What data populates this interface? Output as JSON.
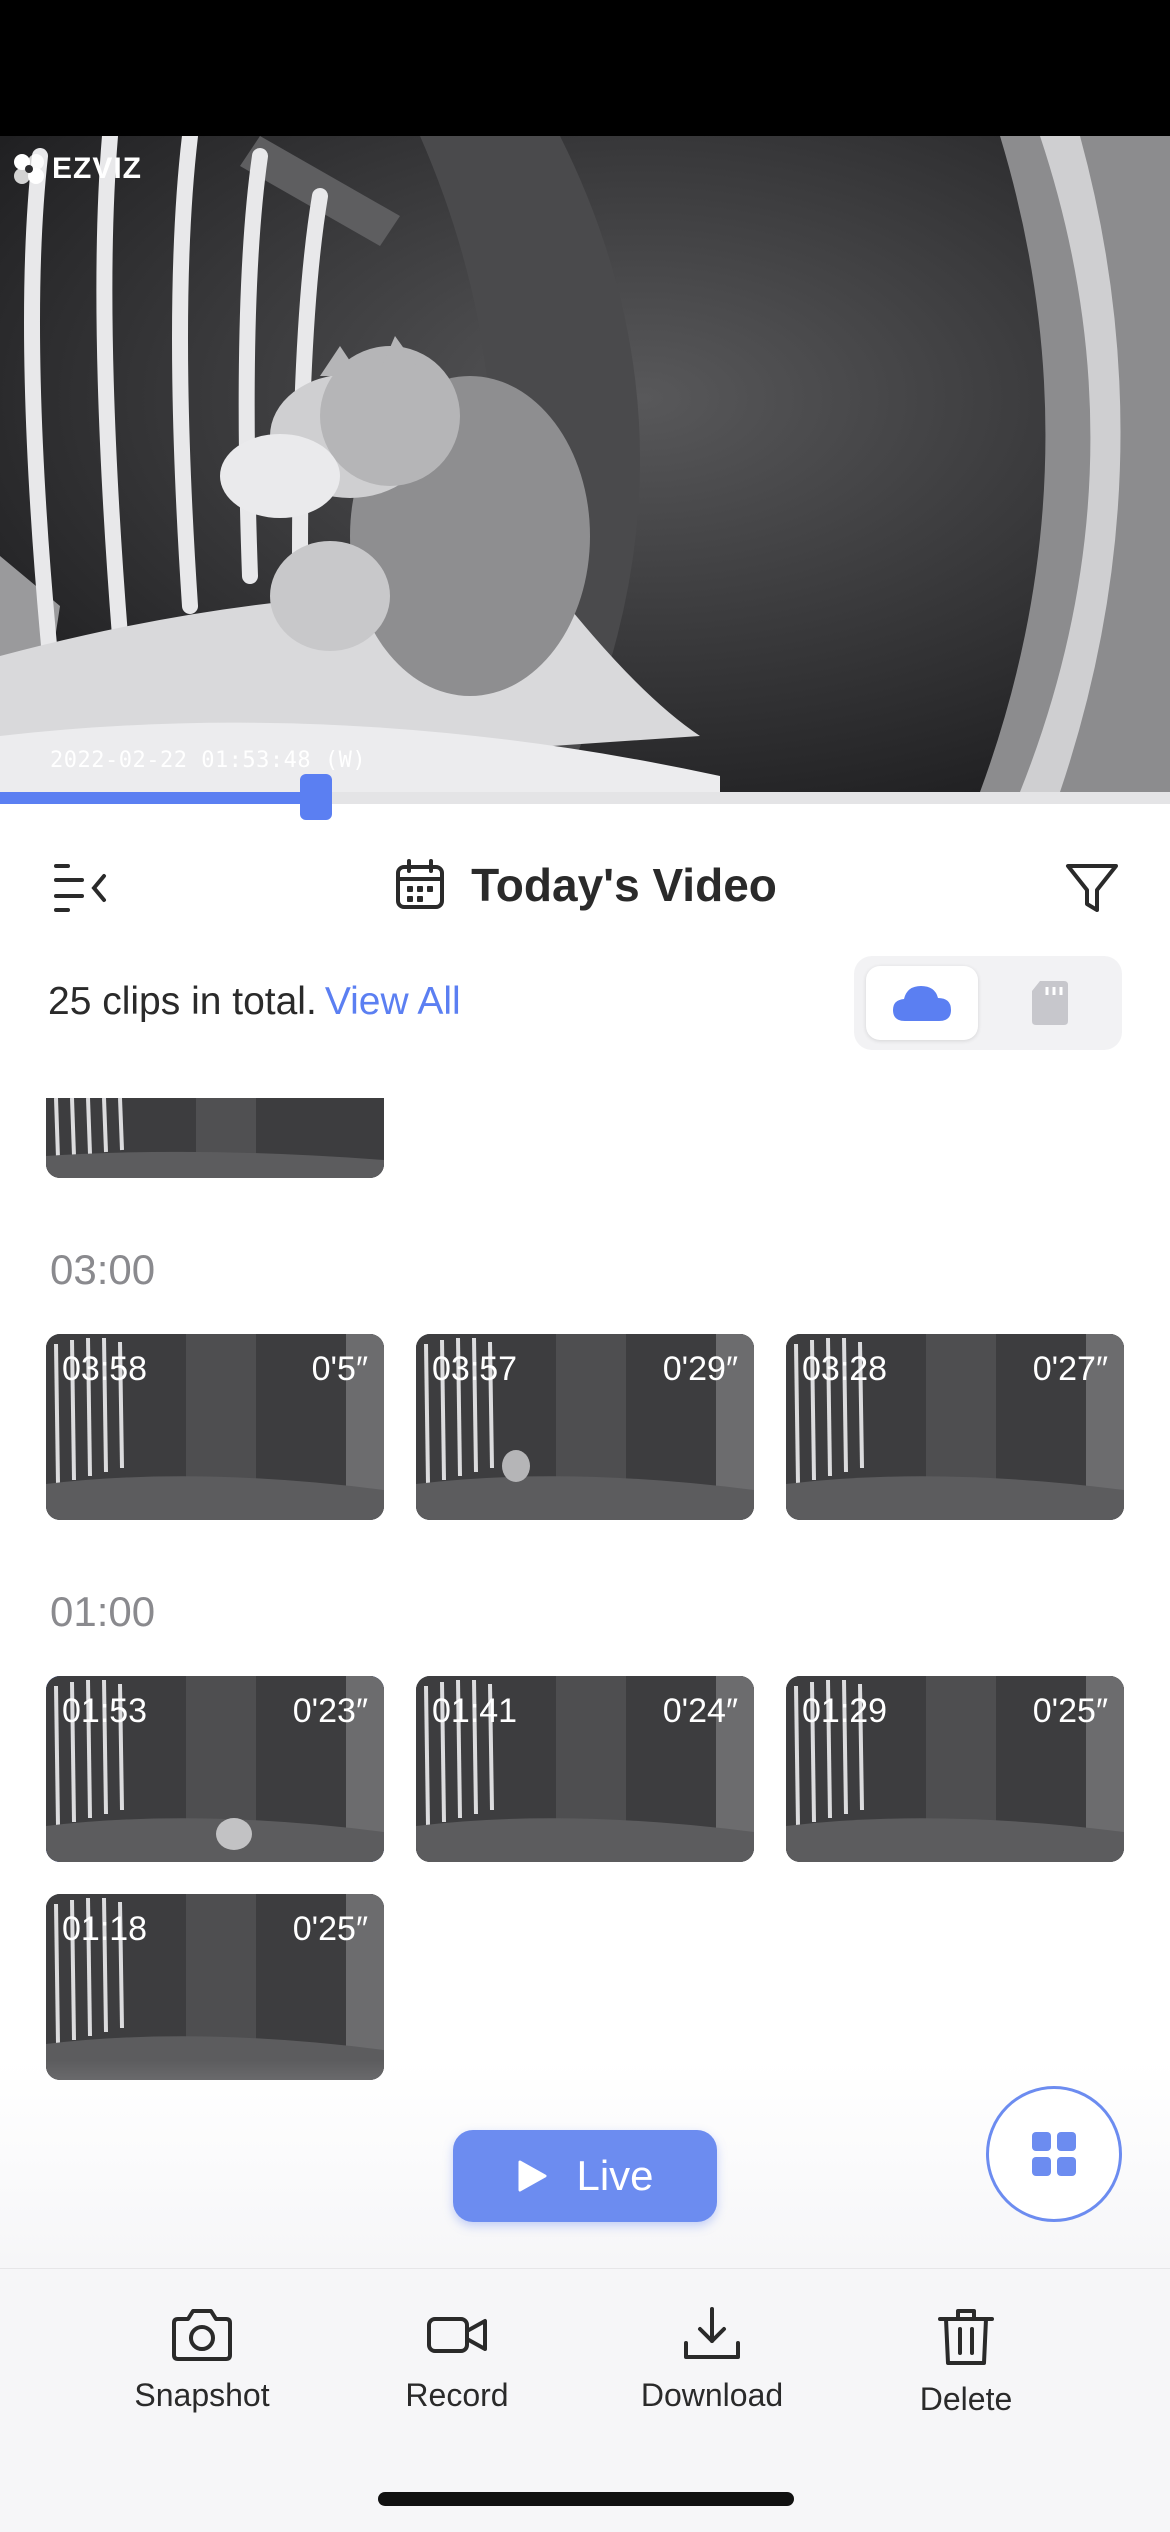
{
  "player": {
    "brand": "EZVIZ",
    "timestamp": "2022-02-22 01:53:48  (W)",
    "progress": 0.27
  },
  "header": {
    "title": "Today's Video",
    "collapse_icon": "collapse-list-icon",
    "calendar_icon": "calendar-icon",
    "filter_icon": "filter-icon"
  },
  "summary": {
    "count_text": "25 clips in total.",
    "view_all": "View All"
  },
  "storage_toggle": {
    "options": [
      "cloud",
      "sd-card"
    ],
    "selected": "cloud"
  },
  "sections": [
    {
      "label": "03:00",
      "clips": [
        {
          "time": "03:58",
          "duration": "0'5″",
          "selected": false
        },
        {
          "time": "03:57",
          "duration": "0'29″",
          "selected": false
        },
        {
          "time": "03:28",
          "duration": "0'27″",
          "selected": false
        }
      ]
    },
    {
      "label": "01:00",
      "clips": [
        {
          "time": "01:53",
          "duration": "0'23″",
          "selected": true
        },
        {
          "time": "01:41",
          "duration": "0'24″",
          "selected": false
        },
        {
          "time": "01:29",
          "duration": "0'25″",
          "selected": false
        },
        {
          "time": "01:18",
          "duration": "0'25″",
          "selected": false
        }
      ]
    }
  ],
  "live_button": {
    "label": "Live"
  },
  "actions": [
    {
      "label": "Snapshot",
      "icon": "camera-icon"
    },
    {
      "label": "Record",
      "icon": "video-camera-icon"
    },
    {
      "label": "Download",
      "icon": "download-icon"
    },
    {
      "label": "Delete",
      "icon": "trash-icon"
    }
  ],
  "colors": {
    "accent": "#5b7ff2",
    "section_label": "#8a8a8e",
    "bottom_bar": "#f6f6f8"
  }
}
